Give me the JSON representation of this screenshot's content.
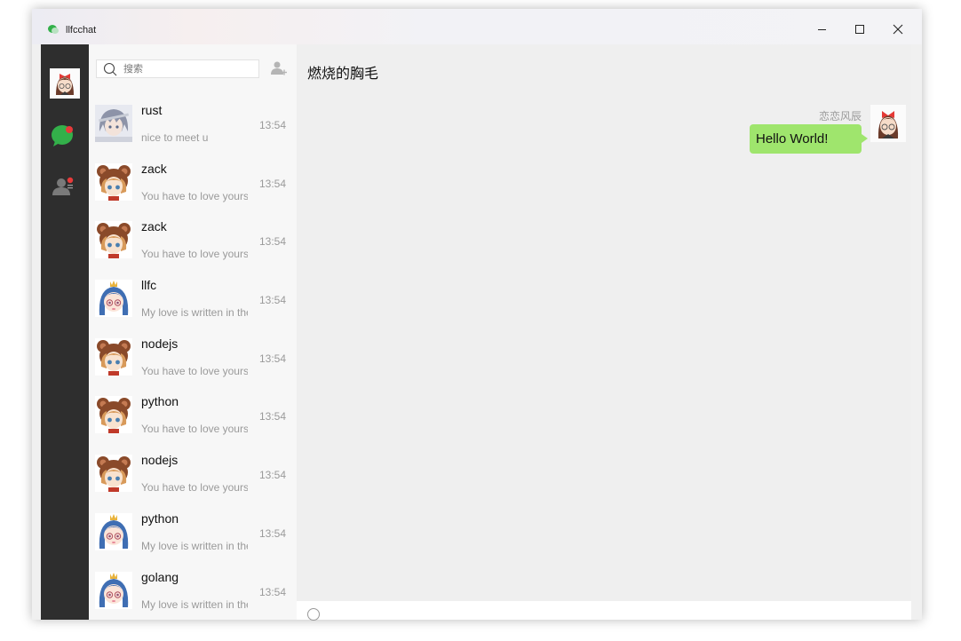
{
  "window": {
    "title": "llfcchat",
    "controls": {
      "minimize_icon": "minimize-icon",
      "maximize_icon": "maximize-icon",
      "close_icon": "close-icon"
    }
  },
  "sidebar": {
    "items": [
      {
        "name": "user-avatar",
        "icon": "avatar"
      },
      {
        "name": "chat",
        "icon": "chat-bubble-icon",
        "active": true,
        "badge_color": "#e83a3a"
      },
      {
        "name": "contacts",
        "icon": "contacts-icon",
        "badge_color": "#e83a3a"
      }
    ]
  },
  "search": {
    "placeholder": "搜索",
    "value": ""
  },
  "chats": [
    {
      "name": "rust",
      "preview": "nice to meet u",
      "time": "13:54",
      "avatar": "anime-boy"
    },
    {
      "name": "zack",
      "preview": "You have to love yourself",
      "time": "13:54",
      "avatar": "bear-hat-girl"
    },
    {
      "name": "zack",
      "preview": "You have to love yourself",
      "time": "13:54",
      "avatar": "bear-hat-girl"
    },
    {
      "name": "llfc",
      "preview": "My love is written in the wind",
      "time": "13:54",
      "avatar": "crown-girl"
    },
    {
      "name": "nodejs",
      "preview": "You have to love yourself",
      "time": "13:54",
      "avatar": "bear-hat-girl"
    },
    {
      "name": "python",
      "preview": "You have to love yourself",
      "time": "13:54",
      "avatar": "bear-hat-girl"
    },
    {
      "name": "nodejs",
      "preview": "You have to love yourself",
      "time": "13:54",
      "avatar": "bear-hat-girl"
    },
    {
      "name": "python",
      "preview": "My love is written in the wind",
      "time": "13:54",
      "avatar": "crown-girl"
    },
    {
      "name": "golang",
      "preview": "My love is written in the wind",
      "time": "13:54",
      "avatar": "crown-girl"
    }
  ],
  "conversation": {
    "title": "燃烧的胸毛",
    "messages": [
      {
        "sender": "恋恋风辰",
        "text": "Hello World!",
        "outgoing": true
      }
    ]
  },
  "colors": {
    "sidebar_bg": "#2e2e2e",
    "accent_green": "#33b04a",
    "bubble": "#9fe56d",
    "badge_red": "#e83a3a"
  }
}
